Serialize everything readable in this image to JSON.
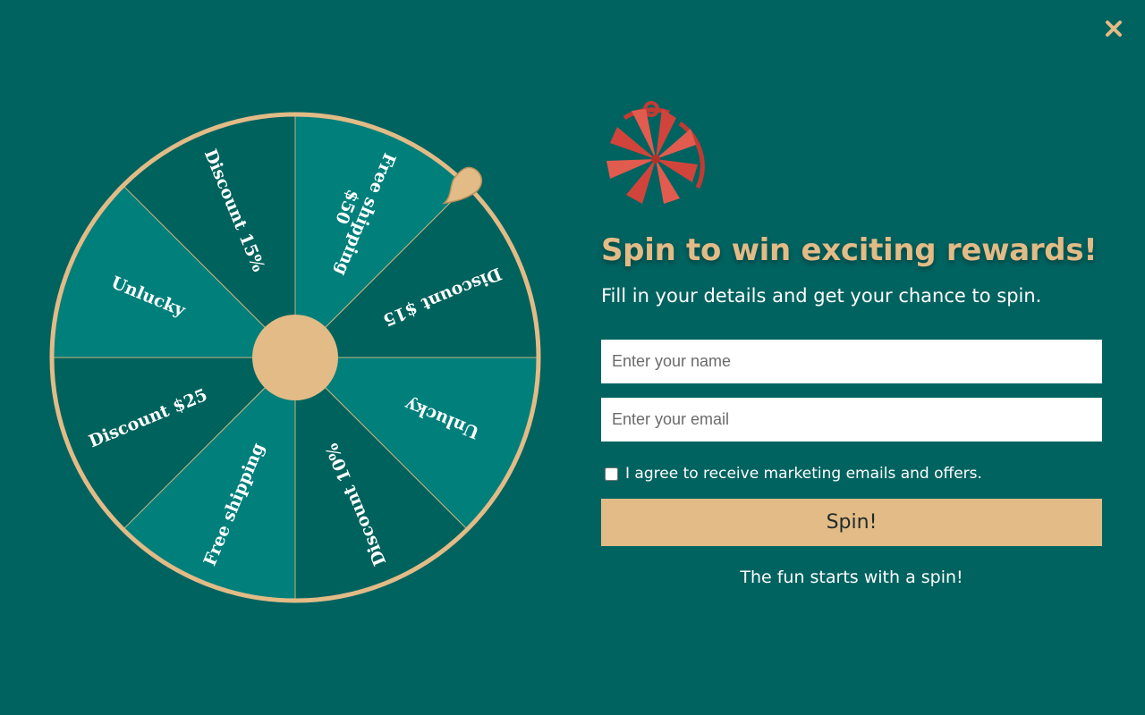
{
  "popup": {
    "close_icon": "close-icon",
    "headline": "Spin to win exciting rewards!",
    "subheadline": "Fill in your details and get your chance to spin.",
    "logo_icon": "gift-wheel-icon"
  },
  "form": {
    "name_placeholder": "Enter your name",
    "name_value": "",
    "email_placeholder": "Enter your email",
    "email_value": "",
    "consent_label": "I agree to receive marketing emails and offers.",
    "consent_checked": false,
    "spin_label": "Spin!",
    "footer_note": "The fun starts with a spin!"
  },
  "wheel": {
    "segments": [
      "Discount $15",
      "Unlucky",
      "Discount 10%",
      "Free shipping",
      "Discount $25",
      "Unlucky",
      "Discount 15%",
      "Free shipping $50"
    ],
    "pointer_icon": "wheel-pointer-icon"
  },
  "colors": {
    "background": "#006360",
    "segment_light": "#007f7b",
    "segment_dark": "#00625d",
    "accent": "#e2bb86",
    "logo_red": "#d1443b"
  }
}
